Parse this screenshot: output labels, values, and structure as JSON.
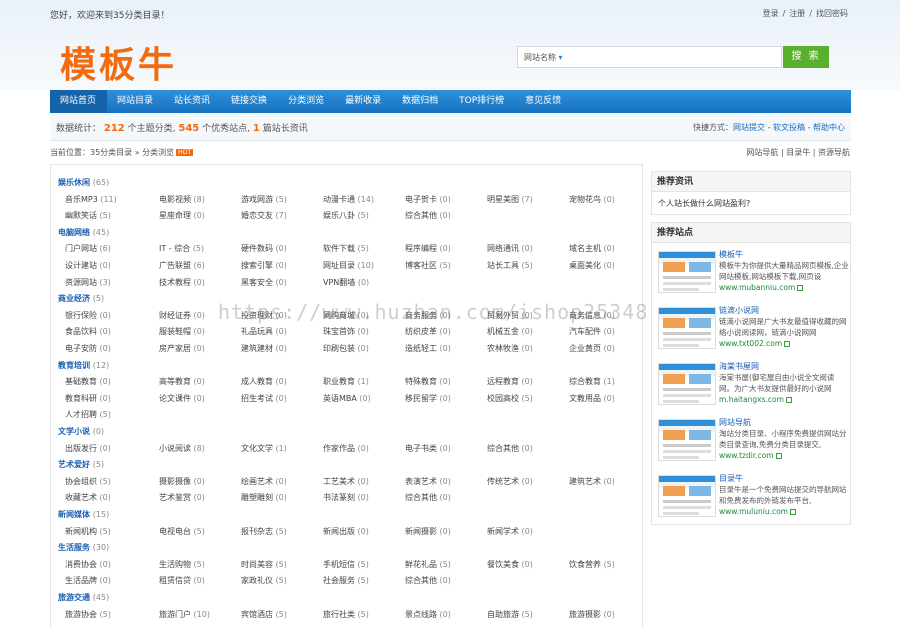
{
  "header": {
    "welcome": "您好，欢迎来到35分类目录！",
    "top_links": [
      "登录",
      "注册",
      "找回密码"
    ],
    "top_sep": "/",
    "logo": "模板牛",
    "search_select": "网站名称",
    "search_placeholder": "",
    "search_button": "搜 索"
  },
  "nav": [
    "网站首页",
    "网站目录",
    "站长资讯",
    "链接交换",
    "分类浏览",
    "最新收录",
    "数据归档",
    "TOP排行榜",
    "意见反馈"
  ],
  "stats": {
    "prefix": "数据统计：",
    "cat_count": "212",
    "cat_label": "个主题分类,",
    "site_count": "545",
    "site_label": "个优秀站点,",
    "news_count": "1",
    "news_label": "篇站长资讯"
  },
  "quick": {
    "prefix": "快捷方式：",
    "links": [
      "网站提交",
      "软文投稿",
      "帮助中心"
    ],
    "sep": "-"
  },
  "breadcrumb": {
    "text": "当前位置：35分类目录 » 分类浏览",
    "tag": "HOT"
  },
  "crumb_right": {
    "links": [
      "网站导航",
      "目录牛",
      "资源导航"
    ],
    "sep": "|"
  },
  "categories": [
    {
      "name": "娱乐休闲",
      "count": "(65)",
      "items": [
        [
          "音乐MP3",
          "(11)"
        ],
        [
          "电影视频",
          "(8)"
        ],
        [
          "游戏网游",
          "(5)"
        ],
        [
          "动漫卡通",
          "(14)"
        ],
        [
          "电子贺卡",
          "(0)"
        ],
        [
          "明星美图",
          "(7)"
        ],
        [
          "宠物花鸟",
          "(0)"
        ],
        [
          "幽默笑话",
          "(5)"
        ],
        [
          "星座命理",
          "(0)"
        ],
        [
          "婚恋交友",
          "(7)"
        ],
        [
          "娱乐八卦",
          "(5)"
        ],
        [
          "综合其他",
          "(0)"
        ]
      ]
    },
    {
      "name": "电脑网络",
      "count": "(45)",
      "items": [
        [
          "门户网站",
          "(6)"
        ],
        [
          "IT - 综合",
          "(5)"
        ],
        [
          "硬件数码",
          "(0)"
        ],
        [
          "软件下载",
          "(5)"
        ],
        [
          "程序编程",
          "(0)"
        ],
        [
          "网络通讯",
          "(0)"
        ],
        [
          "域名主机",
          "(0)"
        ],
        [
          "设计建站",
          "(0)"
        ],
        [
          "广告联盟",
          "(6)"
        ],
        [
          "搜索引擎",
          "(0)"
        ],
        [
          "网址目录",
          "(10)"
        ],
        [
          "博客社区",
          "(5)"
        ],
        [
          "站长工具",
          "(5)"
        ],
        [
          "桌面美化",
          "(0)"
        ],
        [
          "资源网站",
          "(3)"
        ],
        [
          "技术教程",
          "(0)"
        ],
        [
          "黑客安全",
          "(0)"
        ],
        [
          "VPN翻墙",
          "(0)"
        ]
      ]
    },
    {
      "name": "商业经济",
      "count": "(5)",
      "items": [
        [
          "银行保险",
          "(0)"
        ],
        [
          "财经证券",
          "(0)"
        ],
        [
          "投资理财",
          "(0)"
        ],
        [
          "网购商城",
          "(0)"
        ],
        [
          "商务服务",
          "(0)"
        ],
        [
          "贸易外贸",
          "(0)"
        ],
        [
          "商务信息",
          "(0)"
        ],
        [
          "食品饮料",
          "(0)"
        ],
        [
          "服装鞋帽",
          "(0)"
        ],
        [
          "礼品玩具",
          "(0)"
        ],
        [
          "珠宝首饰",
          "(0)"
        ],
        [
          "纺织皮革",
          "(0)"
        ],
        [
          "机械五金",
          "(0)"
        ],
        [
          "汽车配件",
          "(0)"
        ],
        [
          "电子安防",
          "(0)"
        ],
        [
          "房产家居",
          "(0)"
        ],
        [
          "建筑建材",
          "(0)"
        ],
        [
          "印刷包装",
          "(0)"
        ],
        [
          "造纸轻工",
          "(0)"
        ],
        [
          "农林牧渔",
          "(0)"
        ],
        [
          "企业黄页",
          "(0)"
        ]
      ]
    },
    {
      "name": "教育培训",
      "count": "(12)",
      "items": [
        [
          "基础教育",
          "(0)"
        ],
        [
          "高等教育",
          "(0)"
        ],
        [
          "成人教育",
          "(0)"
        ],
        [
          "职业教育",
          "(1)"
        ],
        [
          "特殊教育",
          "(0)"
        ],
        [
          "远程教育",
          "(0)"
        ],
        [
          "综合教育",
          "(1)"
        ],
        [
          "教育科研",
          "(0)"
        ],
        [
          "论文课件",
          "(0)"
        ],
        [
          "招生考试",
          "(0)"
        ],
        [
          "英语MBA",
          "(0)"
        ],
        [
          "移民留学",
          "(0)"
        ],
        [
          "校园高校",
          "(5)"
        ],
        [
          "文教用品",
          "(0)"
        ],
        [
          "人才招聘",
          "(5)"
        ]
      ]
    },
    {
      "name": "文学小说",
      "count": "(0)",
      "items": [
        [
          "出版发行",
          "(0)"
        ],
        [
          "小说阅读",
          "(8)"
        ],
        [
          "文化文学",
          "(1)"
        ],
        [
          "作家作品",
          "(0)"
        ],
        [
          "电子书类",
          "(0)"
        ],
        [
          "综合其他",
          "(0)"
        ]
      ]
    },
    {
      "name": "艺术爱好",
      "count": "(5)",
      "items": [
        [
          "协会组织",
          "(5)"
        ],
        [
          "摄影摄像",
          "(0)"
        ],
        [
          "绘画艺术",
          "(0)"
        ],
        [
          "工艺美术",
          "(0)"
        ],
        [
          "表演艺术",
          "(0)"
        ],
        [
          "传统艺术",
          "(0)"
        ],
        [
          "建筑艺术",
          "(0)"
        ],
        [
          "收藏艺术",
          "(0)"
        ],
        [
          "艺术鉴赏",
          "(0)"
        ],
        [
          "雕塑雕刻",
          "(0)"
        ],
        [
          "书法篆刻",
          "(0)"
        ],
        [
          "综合其他",
          "(0)"
        ]
      ]
    },
    {
      "name": "新闻媒体",
      "count": "(15)",
      "items": [
        [
          "新闻机构",
          "(5)"
        ],
        [
          "电视电台",
          "(5)"
        ],
        [
          "报刊杂志",
          "(5)"
        ],
        [
          "新闻出版",
          "(0)"
        ],
        [
          "新闻摄影",
          "(0)"
        ],
        [
          "新闻学术",
          "(0)"
        ]
      ]
    },
    {
      "name": "生活服务",
      "count": "(30)",
      "items": [
        [
          "消费协会",
          "(0)"
        ],
        [
          "生活购物",
          "(5)"
        ],
        [
          "时尚美容",
          "(5)"
        ],
        [
          "手机短信",
          "(5)"
        ],
        [
          "鲜花礼品",
          "(5)"
        ],
        [
          "餐饮美食",
          "(0)"
        ],
        [
          "饮食营养",
          "(5)"
        ],
        [
          "生活品牌",
          "(0)"
        ],
        [
          "租赁信贷",
          "(0)"
        ],
        [
          "家政礼仪",
          "(5)"
        ],
        [
          "社会服务",
          "(5)"
        ],
        [
          "综合其他",
          "(0)"
        ]
      ]
    },
    {
      "name": "旅游交通",
      "count": "(45)",
      "items": [
        [
          "旅游协会",
          "(5)"
        ],
        [
          "旅游门户",
          "(10)"
        ],
        [
          "宾馆酒店",
          "(5)"
        ],
        [
          "旅行社类",
          "(5)"
        ],
        [
          "景点线路",
          "(0)"
        ],
        [
          "自助旅游",
          "(5)"
        ],
        [
          "旅游摄影",
          "(0)"
        ]
      ]
    }
  ],
  "sidebar": {
    "news_title": "推荐资讯",
    "news_item": "个人站长做什么网站盈利?",
    "sites_title": "推荐站点",
    "sites": [
      {
        "name": "模板牛",
        "desc": "模板牛为你提供大量精品网页模板,企业网站模板,网站模板下载,网页设",
        "url": "www.mubanniu.com"
      },
      {
        "name": "链滴小说网",
        "desc": "链滴小说网是广大书友最值得收藏的网络小说阅读网，链滴小说网网",
        "url": "www.txt002.com"
      },
      {
        "name": "海棠书屋网",
        "desc": "海棠书屋(御宅屋自由小说全文阅读网。为广大书友提供最好的小说网",
        "url": "m.haitangxs.com"
      },
      {
        "name": "网站导航",
        "desc": "淘站分类目录、小程序免费提供网站分类目录查询,免费分类目录提交,",
        "url": "www.tzdir.com"
      },
      {
        "name": "目录牛",
        "desc": "目录牛是一个免费网站提交的导航网站和免费发布的外链发布平台,",
        "url": "www.muluniu.com"
      }
    ]
  },
  "watermark": "https://www.huzhan.com/ishop25348"
}
